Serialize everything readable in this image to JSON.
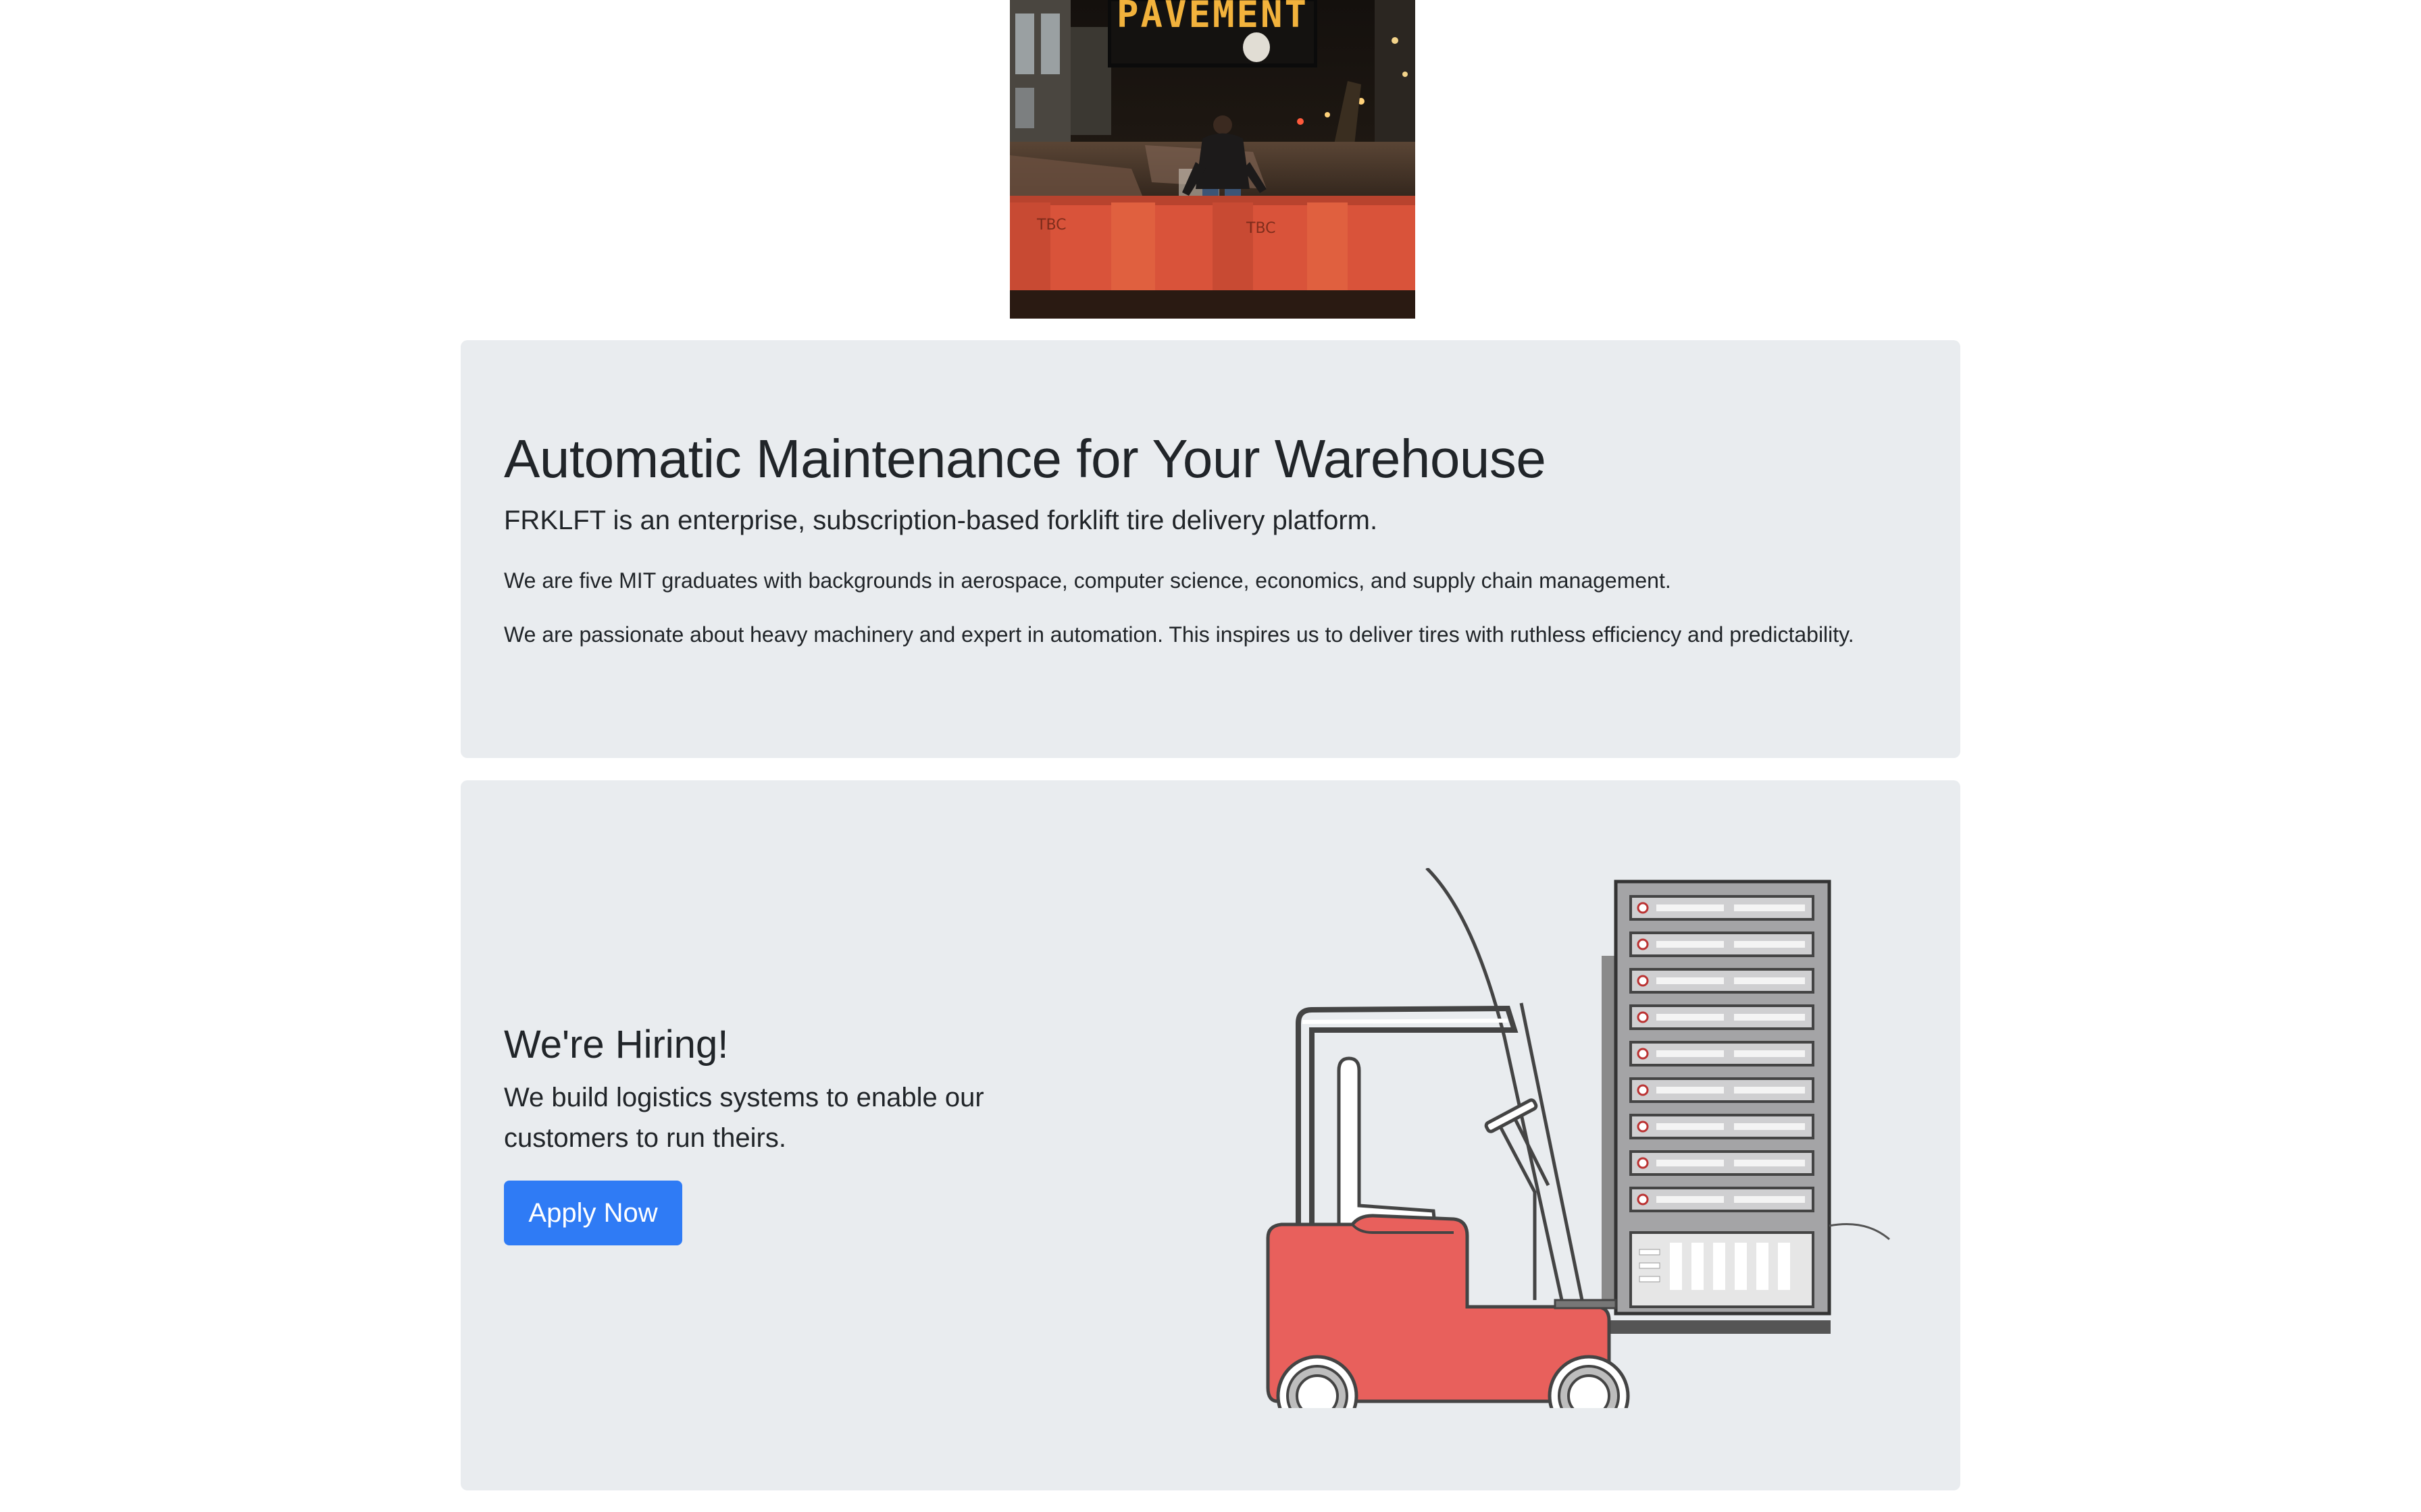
{
  "hero": {
    "sign_text": "PAVEMENT"
  },
  "about": {
    "title": "Automatic Maintenance for Your Warehouse",
    "lead": "FRKLFT is an enterprise, subscription-based forklift tire delivery platform.",
    "paragraph_1": "We are five MIT graduates with backgrounds in aerospace, computer science, economics, and supply chain management.",
    "paragraph_2": "We are passionate about heavy machinery and expert in automation. This inspires us to deliver tires with ruthless efficiency and predictability."
  },
  "hiring": {
    "title": "We're Hiring!",
    "lead": "We build logistics systems to enable our customers to run theirs.",
    "button_label": "Apply Now"
  },
  "colors": {
    "card_background": "#e9ecef",
    "button": "#2f7bf5",
    "forklift_body": "#e8605c",
    "text": "#212529"
  }
}
